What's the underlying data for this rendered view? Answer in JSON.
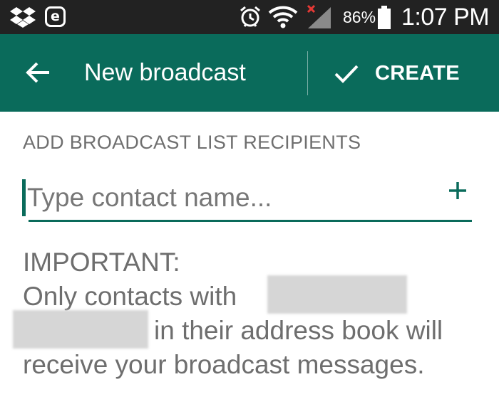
{
  "status_bar": {
    "battery_percent": "86%",
    "time": "1:07 PM",
    "notification_icons": [
      "dropbox-icon",
      "e-app-icon"
    ],
    "system_icons": [
      "alarm-icon",
      "wifi-icon",
      "signal-icon",
      "battery-icon"
    ]
  },
  "app_bar": {
    "title": "New broadcast",
    "create_label": "CREATE",
    "color": "#0a6b5b"
  },
  "recipients": {
    "section_label": "ADD BROADCAST LIST RECIPIENTS",
    "input_placeholder": "Type contact name...",
    "input_value": ""
  },
  "notice": {
    "heading": "IMPORTANT:",
    "line1": "Only contacts with",
    "line2": "in their address book will",
    "line3": "receive your broadcast messages."
  },
  "colors": {
    "accent": "#0a6b5b",
    "status_bar": "#222222",
    "secondary_text": "#6e6e6e"
  }
}
